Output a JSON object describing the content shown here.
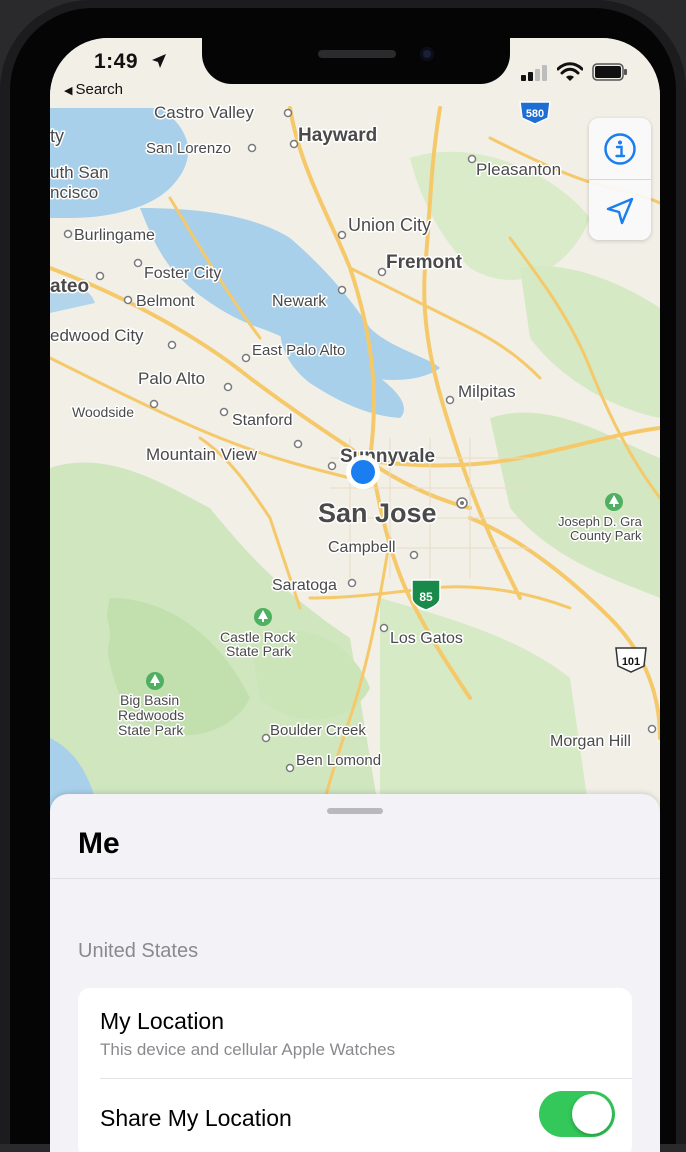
{
  "status_bar": {
    "time": "1:49",
    "back_label": "Search"
  },
  "map": {
    "places": [
      "Castro Valley",
      "Hayward",
      "San Lorenzo",
      "Pleasanton",
      "uth San",
      "ncisco",
      "ty",
      "Burlingame",
      "Union City",
      "Foster City",
      "Fremont",
      "ateo",
      "Belmont",
      "Newark",
      "edwood City",
      "East Palo Alto",
      "Palo Alto",
      "Milpitas",
      "Woodside",
      "Stanford",
      "Mountain View",
      "Sunnyvale",
      "San Jose",
      "Joseph D. Gra",
      "County Park",
      "Campbell",
      "Saratoga",
      "Castle Rock",
      "State Park",
      "Los Gatos",
      "Big Basin",
      "Redwoods",
      "State Park",
      "Boulder Creek",
      "Morgan Hill",
      "Ben Lomond"
    ],
    "highway_shields": [
      "580",
      "85",
      "101"
    ]
  },
  "sheet": {
    "title": "Me",
    "section": "United States",
    "my_location": {
      "title": "My Location",
      "subtitle": "This device and cellular Apple Watches"
    },
    "share": {
      "title": "Share My Location",
      "enabled": true
    }
  },
  "colors": {
    "water": "#a8d0ea",
    "land": "#f2efe7",
    "park": "#c8e3b8",
    "road": "#f5c96a",
    "accent": "#1a7ef0",
    "toggle_on": "#34c759"
  },
  "icons": [
    "location-arrow-icon",
    "back-triangle-icon",
    "signal-icon",
    "wifi-icon",
    "battery-icon",
    "info-icon",
    "locate-me-icon",
    "park-icon"
  ]
}
